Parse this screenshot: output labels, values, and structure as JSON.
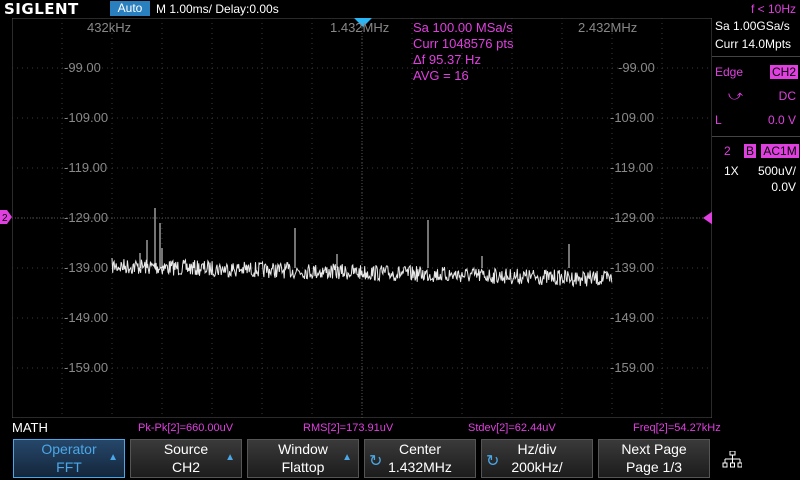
{
  "topbar": {
    "brand": "SIGLENT",
    "mode": "Auto",
    "timebase": "M 1.00ms/ Delay:0.00s",
    "trigger_freq": "f < 10Hz"
  },
  "overlay": {
    "freq_left": "432kHz",
    "freq_center": "1.432MHz",
    "freq_right": "2.432MHz",
    "db_labels": [
      "-99.00",
      "-109.00",
      "-119.00",
      "-129.00",
      "-139.00",
      "-149.00",
      "-159.00"
    ],
    "info": {
      "sa": "Sa 100.00 MSa/s",
      "curr": "Curr 1048576 pts",
      "df": "Δf 95.37 Hz",
      "avg": "AVG = 16"
    }
  },
  "rpanel": {
    "sa": "Sa 1.00GSa/s",
    "curr": "Curr 14.0Mpts",
    "trig_type": "Edge",
    "trig_src": "CH2",
    "trig_coupling": "DC",
    "trig_level_label": "L",
    "trig_level": "0.0 V",
    "ch_num": "2",
    "ch_bw": "B",
    "ch_coupling": "AC1M",
    "probe": "1X",
    "vdiv": "500uV/",
    "offset": "0.0V"
  },
  "measure": {
    "title": "MATH",
    "pkpk": "Pk-Pk[2]=660.00uV",
    "rms": "RMS[2]=173.91uV",
    "stdev": "Stdev[2]=62.44uV",
    "freq": "Freq[2]=54.27kHz"
  },
  "menu": {
    "operator": {
      "title": "Operator",
      "value": "FFT"
    },
    "source": {
      "title": "Source",
      "value": "CH2"
    },
    "window": {
      "title": "Window",
      "value": "Flattop"
    },
    "center": {
      "title": "Center",
      "value": "1.432MHz"
    },
    "hzdiv": {
      "title": "Hz/div",
      "value": "200kHz/"
    },
    "nextpage": {
      "title": "Next Page",
      "value": "Page 1/3"
    }
  },
  "colors": {
    "accent": "#e040e0",
    "menu_active": "#4aa8e8",
    "trace": "#e8e8e8"
  }
}
